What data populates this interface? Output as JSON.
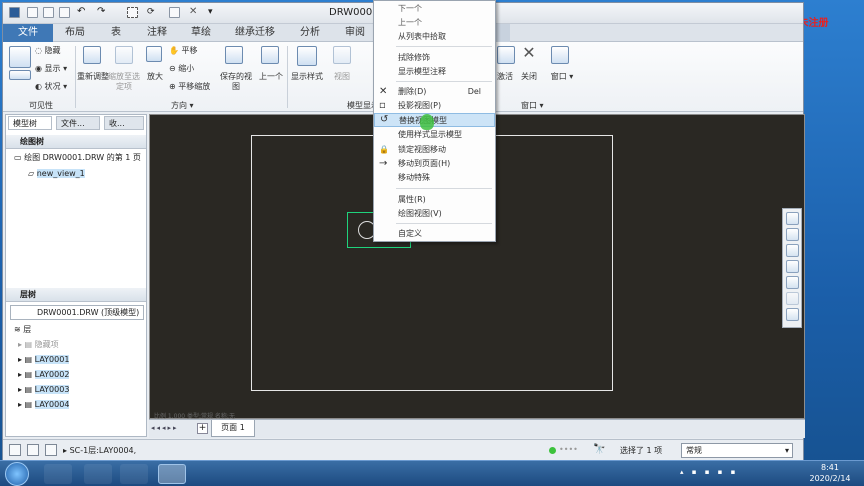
{
  "window": {
    "title": "DRW0001"
  },
  "watermark": "屏幕录像专家 未注册",
  "tabs": [
    "文件",
    "布局",
    "表",
    "注释",
    "草绘",
    "继承迁移",
    "分析",
    "审阅"
  ],
  "ribbon": {
    "buttons": {
      "hide": "隐藏",
      "show": "显示",
      "status": "状况",
      "repaint": "重新调整",
      "zoom_fit": "缩放至选定项",
      "zoom_in": "放大",
      "pan": "平移",
      "zoom_out": "缩小",
      "pan_zoom": "平移缩放",
      "saved_view": "保存的视图",
      "previous": "上一个",
      "display_style": "显示样式",
      "view_mgr": "视图",
      "activate": "激活",
      "close": "关闭",
      "window": "窗口"
    },
    "groups": {
      "visibility": "可见性",
      "orientation": "方向",
      "model_display": "模型显示",
      "window": "窗口"
    }
  },
  "left_panel": {
    "tabs": [
      "模型树",
      "文件...",
      "收..."
    ],
    "draw_tree_header": "绘图树",
    "draw_tree_root": "绘图 DRW0001.DRW 的第 1 页",
    "draw_tree_child": "new_view_1",
    "layer_header": "层树",
    "layer_select": "DRW0001.DRW (顶级模型)",
    "layer_root": "层",
    "layers": [
      "隐藏项",
      "LAY0001",
      "LAY0002",
      "LAY0003",
      "LAY0004"
    ]
  },
  "context_menu": {
    "items": [
      {
        "label": "下一个",
        "icon": ""
      },
      {
        "label": "上一个",
        "icon": ""
      },
      {
        "label": "从列表中拾取",
        "icon": ""
      },
      {
        "label": "拭除修饰",
        "icon": ""
      },
      {
        "label": "显示模型注释",
        "icon": ""
      },
      {
        "label": "删除(D)",
        "shortcut": "Del",
        "icon": "✕"
      },
      {
        "label": "投影视图(P)",
        "icon": "▫"
      },
      {
        "label": "替换视图模型",
        "icon": "↺"
      },
      {
        "label": "使用样式显示模型",
        "icon": ""
      },
      {
        "label": "锁定视图移动",
        "icon": "🔒"
      },
      {
        "label": "移动到页面(H)",
        "icon": "→"
      },
      {
        "label": "移动特殊",
        "icon": ""
      },
      {
        "label": "属性(R)",
        "icon": ""
      },
      {
        "label": "绘图视图(V)",
        "icon": ""
      },
      {
        "label": "自定义",
        "icon": ""
      }
    ]
  },
  "page_bar": {
    "page_tab": "页面 1",
    "ruler_text": "比例 1.000  类型:常规  名称:无"
  },
  "status": {
    "left_text": "SC-1层:LAY0004,",
    "selected_text": "选择了 1 项",
    "filter_value": "常规"
  },
  "taskbar": {
    "time": "8:41",
    "date": "2020/2/14"
  }
}
